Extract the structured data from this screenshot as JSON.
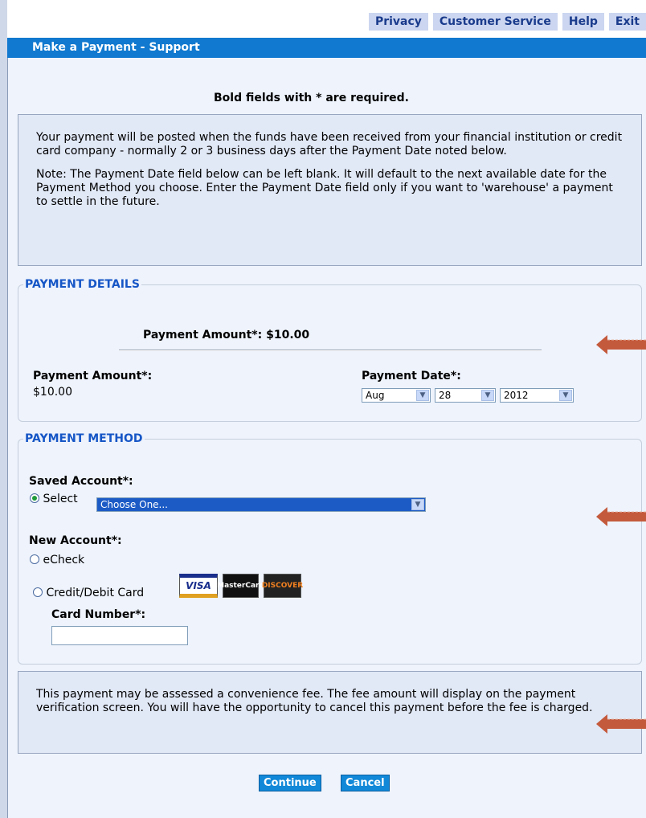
{
  "nav": {
    "privacy": "Privacy",
    "customer_service": "Customer Service",
    "help": "Help",
    "exit": "Exit"
  },
  "page_title": "Make a Payment - Support",
  "required_note": "Bold fields with * are required.",
  "info": {
    "para1": "Your payment will be posted when the funds have been received from your financial institution or credit card company - normally 2 or 3 business days after the Payment Date noted below.",
    "para2": "Note: The Payment Date field below can be left blank. It will default to the next available date for the Payment Method you choose. Enter the Payment Date field only if you want to 'warehouse' a payment to settle in the future."
  },
  "payment_details": {
    "legend": "PAYMENT DETAILS",
    "summary": "Payment Amount*: $10.00",
    "amount_label": "Payment Amount*:",
    "amount_value": "$10.00",
    "date_label": "Payment Date*:",
    "month": "Aug",
    "day": "28",
    "year": "2012"
  },
  "payment_method": {
    "legend": "PAYMENT METHOD",
    "saved_label": "Saved Account*:",
    "select_radio_label": "Select",
    "saved_dropdown": "Choose One...",
    "new_label": "New Account*:",
    "echeck_label": "eCheck",
    "card_label": "Credit/Debit Card",
    "card_logos": [
      "VISA",
      "MasterCard",
      "DISCOVER"
    ],
    "card_number_label": "Card Number*:",
    "card_number_value": ""
  },
  "fee_note": "This payment may be assessed a convenience fee. The fee amount will display on the payment verification screen. You will have the opportunity to cancel this payment before the fee is charged.",
  "buttons": {
    "continue": "Continue",
    "cancel": "Cancel"
  },
  "colors": {
    "title_bar": "#1179cf",
    "nav_bg": "#ccd6f0",
    "legend_text": "#1656c6",
    "annotation_arrow": "#c45a3c"
  }
}
